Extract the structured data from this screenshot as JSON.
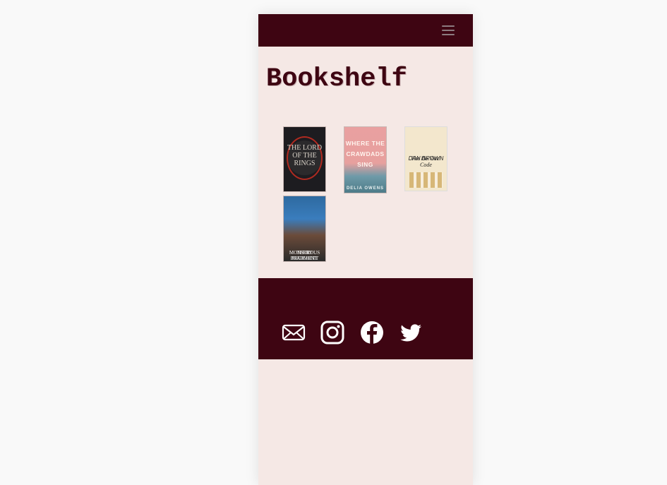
{
  "header": {
    "menu_icon": "hamburger-menu-icon"
  },
  "page": {
    "title": "Bookshelf"
  },
  "books": [
    {
      "title_lines": "THE LORD OF THE RINGS",
      "alt": "The Lord of the Rings"
    },
    {
      "title_lines": "WHERE THE CRAWDADS SING",
      "author": "DELIA OWENS",
      "alt": "Where the Crawdads Sing"
    },
    {
      "author": "DAN BROWN",
      "title_lines": "The Da Vinci Code",
      "alt": "The Da Vinci Code"
    },
    {
      "author": "TERRY PRATCHETT",
      "title_lines": "MONSTROUS REGIMENT",
      "alt": "Monstrous Regiment"
    }
  ],
  "footer": {
    "icons": [
      "mail-icon",
      "instagram-icon",
      "facebook-icon",
      "twitter-icon"
    ]
  },
  "colors": {
    "brand_dark": "#3e0512",
    "page_bg": "#f5e8e5",
    "outer_bg": "#f9f9f9"
  }
}
